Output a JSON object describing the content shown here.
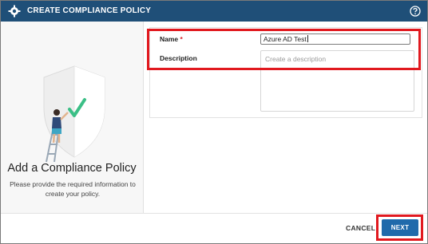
{
  "window": {
    "title": "CREATE COMPLIANCE POLICY",
    "app_icon": "shield-gear-icon",
    "help_icon": "question-circle-icon"
  },
  "left_panel": {
    "illustration": "person-painting-shield-checkmark",
    "heading": "Add a Compliance Policy",
    "description": "Please provide the required information to create your policy."
  },
  "form": {
    "name_label": "Name",
    "required_marker": "*",
    "name_value": "Azure AD Test",
    "description_label": "Description",
    "description_placeholder": "Create a description"
  },
  "footer": {
    "cancel_label": "CANCEL",
    "next_label": "NEXT"
  },
  "colors": {
    "titlebar": "#1f4f78",
    "primary_button": "#1f6aab",
    "highlight": "#e1191f",
    "required": "#d8232a",
    "checkmark": "#3bbf86"
  }
}
